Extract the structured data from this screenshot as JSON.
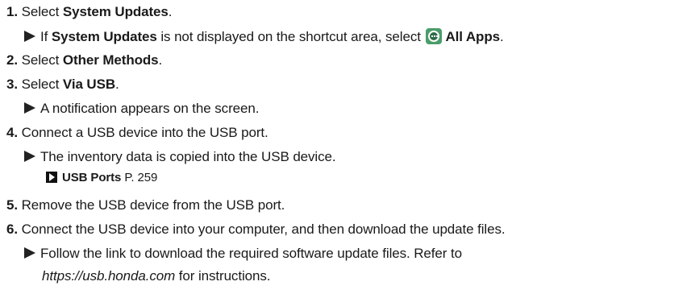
{
  "steps": [
    {
      "num": "1.",
      "pre": "Select ",
      "bold": "System Updates",
      "post": ".",
      "sub": {
        "pre": "If ",
        "bold1": "System Updates",
        "mid": " is not displayed on the shortcut area, select ",
        "icon": "all-apps-icon",
        "bold2": "All Apps",
        "post": "."
      }
    },
    {
      "num": "2.",
      "pre": "Select ",
      "bold": "Other Methods",
      "post": "."
    },
    {
      "num": "3.",
      "pre": "Select ",
      "bold": "Via USB",
      "post": ".",
      "sub": {
        "text": "A notification appears on the screen."
      }
    },
    {
      "num": "4.",
      "text": "Connect a USB device into the USB port.",
      "sub": {
        "text": "The inventory data is copied into the USB device."
      },
      "ref": {
        "bold": "USB Ports",
        "page": " P. 259"
      }
    },
    {
      "num": "5.",
      "text": "Remove the USB device from the USB port."
    },
    {
      "num": "6.",
      "text": "Connect the USB device into your computer, and then download the update files.",
      "sub": {
        "line1": "Follow the link to download the required software update files. Refer to",
        "url": "https://usb.honda.com",
        "line2_post": " for instructions."
      }
    }
  ]
}
